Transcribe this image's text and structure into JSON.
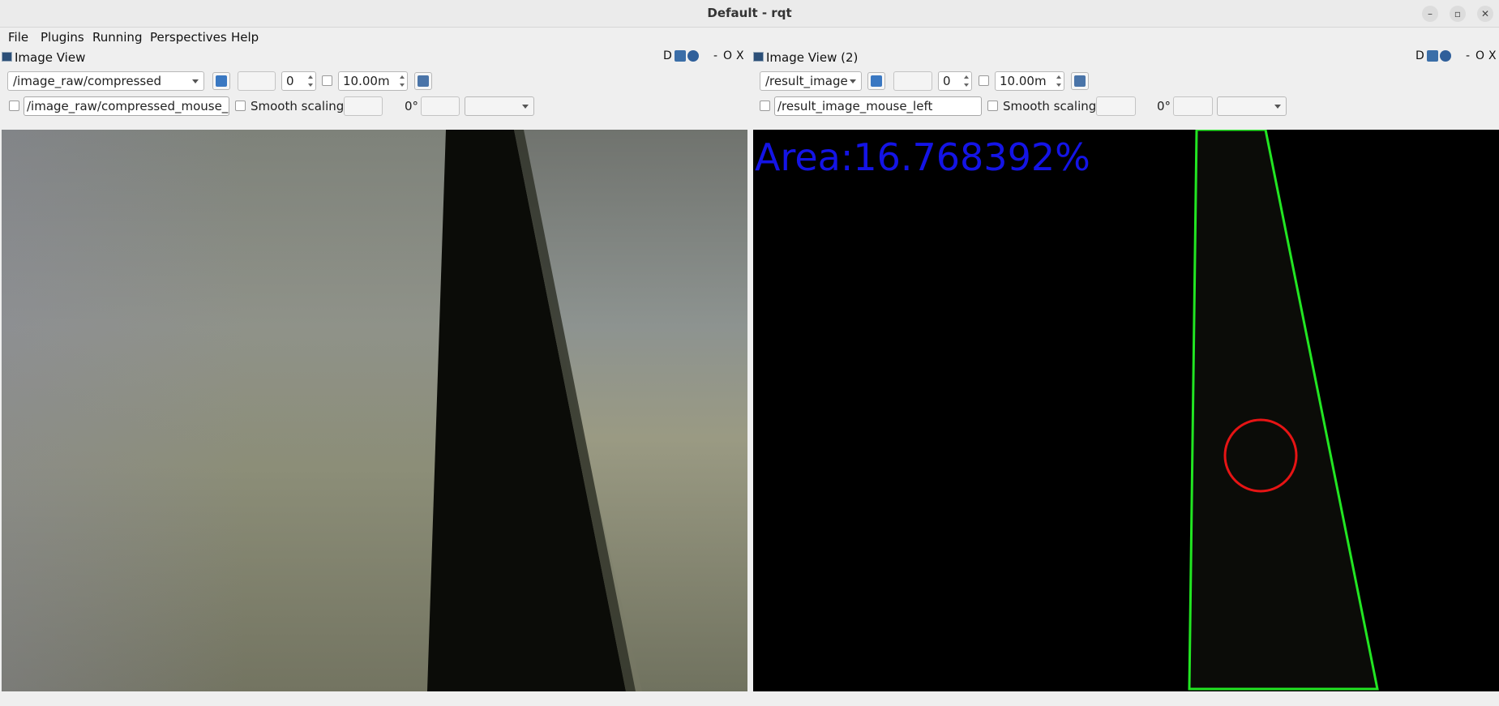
{
  "window": {
    "title": "Default - rqt",
    "controls": [
      "minimize",
      "maximize",
      "close"
    ]
  },
  "menubar": {
    "items": [
      {
        "label": "File",
        "accel": "F"
      },
      {
        "label": "Plugins",
        "accel": "P"
      },
      {
        "label": "Running",
        "accel": "R"
      },
      {
        "label": "Perspectives",
        "accel": "e"
      },
      {
        "label": "Help",
        "accel": "H"
      }
    ]
  },
  "left_panel": {
    "title": "Image View",
    "dock_controls": {
      "d_label": "D",
      "minimize": "-",
      "float": "O",
      "close": "X"
    },
    "topic": "/image_raw/compressed",
    "rotation_value": "0",
    "timeout": "10.00m",
    "mouse_topic": "/image_raw/compressed_mouse_left",
    "smooth_scaling_label": "Smooth scaling",
    "rotation_label": "0°"
  },
  "right_panel": {
    "title": "Image View (2)",
    "dock_controls": {
      "d_label": "D",
      "minimize": "-",
      "float": "O",
      "close": "X"
    },
    "topic": "/result_image",
    "rotation_value": "0",
    "timeout": "10.00m",
    "mouse_topic": "/result_image_mouse_left",
    "smooth_scaling_label": "Smooth scaling",
    "rotation_label": "0°",
    "overlay_text": "Area:16.768392%"
  },
  "colors": {
    "overlay_text": "#1414e6",
    "contour": "#22e622",
    "circle": "#e61414",
    "dark_band": "#0b0c08",
    "camera_light": "#8e9488"
  }
}
